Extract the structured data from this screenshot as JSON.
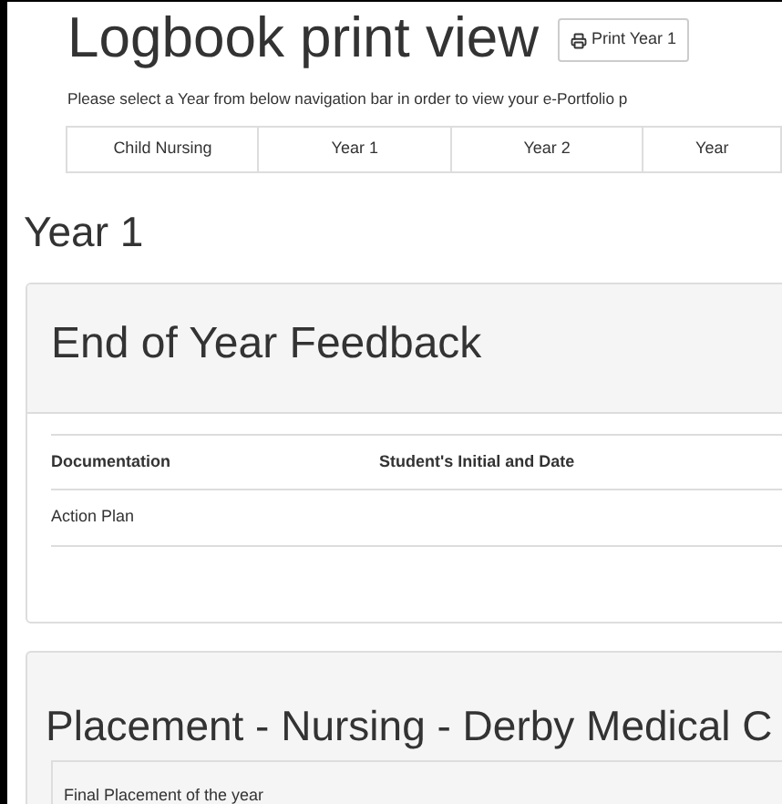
{
  "header": {
    "title": "Logbook print view",
    "print_button": "Print Year 1",
    "instructions": "Please select a Year from below navigation bar in order to view your e-Portfolio p"
  },
  "tabs": [
    {
      "label": "Child Nursing"
    },
    {
      "label": "Year 1"
    },
    {
      "label": "Year 2"
    },
    {
      "label": "Year"
    }
  ],
  "year_heading": "Year 1",
  "feedback_panel": {
    "title": "End of Year Feedback",
    "columns": [
      "Documentation",
      "Student's Initial and Date"
    ],
    "rows": [
      [
        "Action Plan",
        ""
      ]
    ]
  },
  "placement_panel": {
    "title": "Placement - Nursing - Derby Medical C",
    "note": "Final Placement of the year"
  }
}
